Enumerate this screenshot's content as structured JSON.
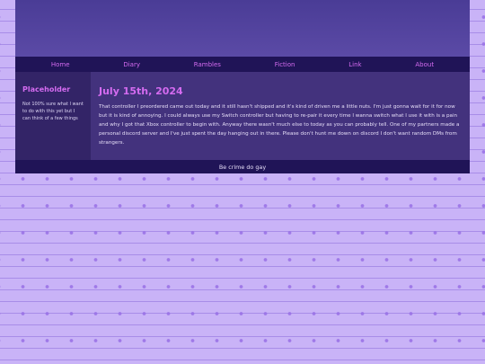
{
  "nav": [
    "Home",
    "Diary",
    "Rambles",
    "Fiction",
    "Link",
    "About"
  ],
  "sidebar": {
    "title": "Placeholder",
    "text": "Not 100% sure what I want to do with this yet but I can think of a few things"
  },
  "post": {
    "date": "July 15th, 2024",
    "body": "That controller I preordered came out today and it still hasn't shipped and it's kind of driven me a little nuts. I'm just gonna wait for it for now but it is kind of annoying. I could always use my Switch controller but having to re-pair it every time I wanna switch what I use it with is a pain and why I got that Xbox controller to begin with. Anyway there wasn't much else to today as you can probably tell. One of my partners made a personal discord server and I've just spent the day hanging out in there. Please don't hunt me down on discord I don't want random DMs from strangers."
  },
  "footer": "Be crime do gay",
  "colors": {
    "accent": "#d46bf0",
    "nav_bg": "#201457",
    "content_bg": "#43327d",
    "sidebar_bg": "#332467",
    "page_bg": "#c9b3f7"
  }
}
